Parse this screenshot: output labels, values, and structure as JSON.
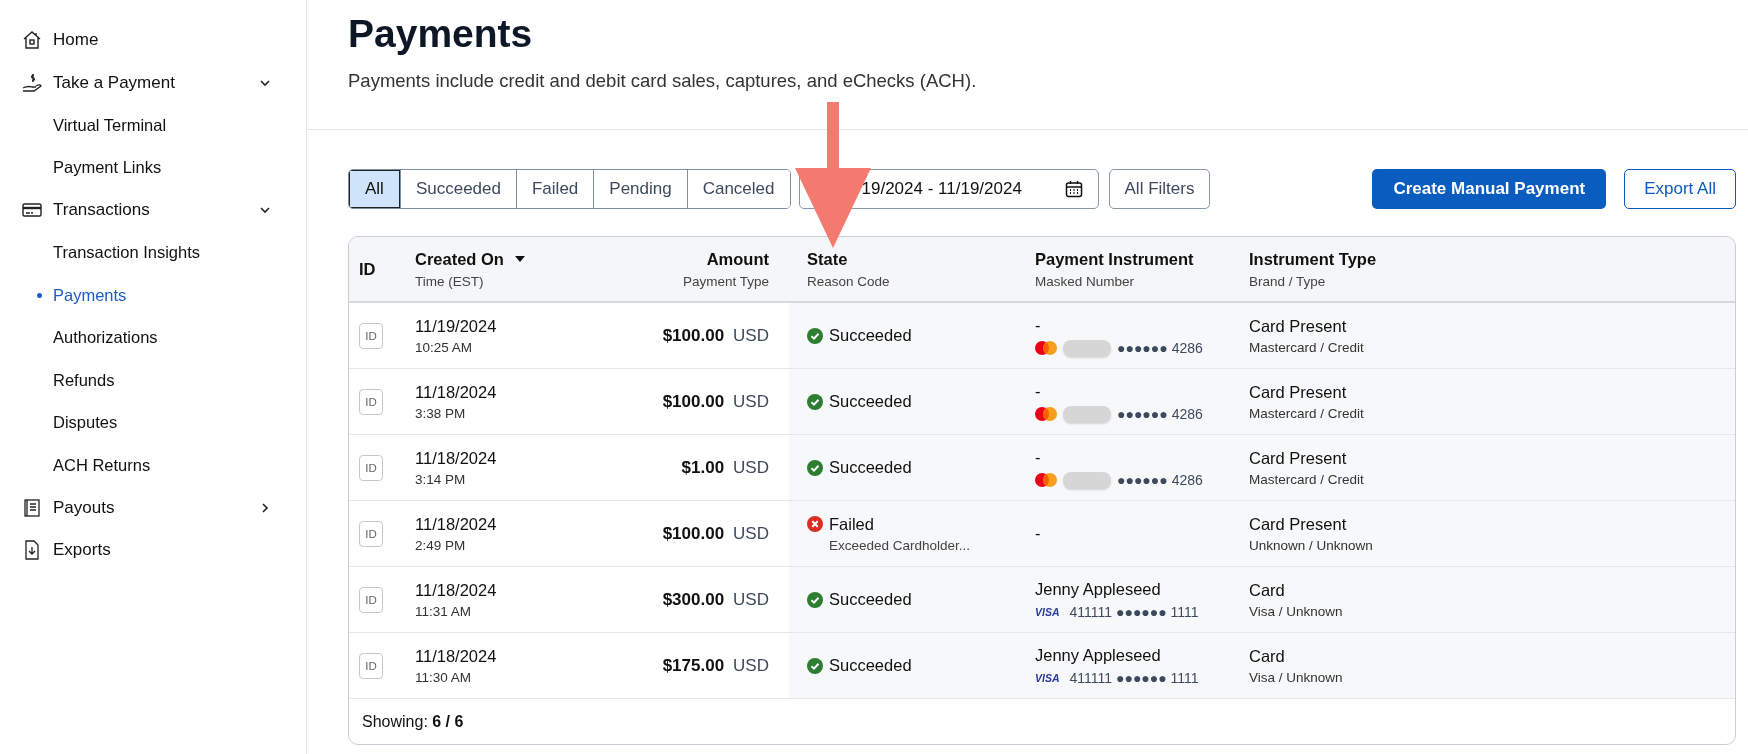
{
  "sidebar": {
    "items": [
      {
        "label": "Home"
      },
      {
        "label": "Take a Payment",
        "expanded": true,
        "children": [
          {
            "label": "Virtual Terminal",
            "selected": false
          },
          {
            "label": "Payment Links",
            "selected": false
          }
        ]
      },
      {
        "label": "Transactions",
        "expanded": true,
        "children": [
          {
            "label": "Transaction Insights",
            "selected": false
          },
          {
            "label": "Payments",
            "selected": true
          },
          {
            "label": "Authorizations",
            "selected": false
          },
          {
            "label": "Refunds",
            "selected": false
          },
          {
            "label": "Disputes",
            "selected": false
          },
          {
            "label": "ACH Returns",
            "selected": false
          }
        ]
      },
      {
        "label": "Payouts",
        "expanded": false
      },
      {
        "label": "Exports"
      }
    ]
  },
  "page": {
    "title": "Payments",
    "subtitle": "Payments include credit and debit card sales, captures, and eChecks (ACH)."
  },
  "filters": {
    "tabs": [
      {
        "label": "All",
        "selected": true
      },
      {
        "label": "Succeeded",
        "selected": false
      },
      {
        "label": "Failed",
        "selected": false
      },
      {
        "label": "Pending",
        "selected": false
      },
      {
        "label": "Canceled",
        "selected": false
      }
    ],
    "date_range": "19/2024 - 11/19/2024",
    "all_filters": "All Filters"
  },
  "actions": {
    "primary": "Create Manual Payment",
    "secondary": "Export All"
  },
  "table": {
    "columns": [
      {
        "title": "ID"
      },
      {
        "title": "Created On",
        "subtitle": "Time (EST)",
        "sorted": true
      },
      {
        "title": "Amount",
        "subtitle": "Payment Type"
      },
      {
        "title": "State",
        "subtitle": "Reason Code"
      },
      {
        "title": "Payment Instrument",
        "subtitle": "Masked Number"
      },
      {
        "title": "Instrument Type",
        "subtitle": "Brand / Type"
      }
    ],
    "rows": [
      {
        "id": "ID",
        "date": "11/19/2024",
        "time": "10:25 AM",
        "amount": "$100.00",
        "currency": "USD",
        "state": {
          "kind": "succeeded",
          "label": "Succeeded"
        },
        "instrument": {
          "name": "-",
          "kind": "mastercard",
          "redacted": true,
          "masked": "●●●●●● 4286"
        },
        "type": "Card Present",
        "brand_type": "Mastercard / Credit"
      },
      {
        "id": "ID",
        "date": "11/18/2024",
        "time": "3:38 PM",
        "amount": "$100.00",
        "currency": "USD",
        "state": {
          "kind": "succeeded",
          "label": "Succeeded"
        },
        "instrument": {
          "name": "-",
          "kind": "mastercard",
          "redacted": true,
          "masked": "●●●●●● 4286"
        },
        "type": "Card Present",
        "brand_type": "Mastercard / Credit"
      },
      {
        "id": "ID",
        "date": "11/18/2024",
        "time": "3:14 PM",
        "amount": "$1.00",
        "currency": "USD",
        "state": {
          "kind": "succeeded",
          "label": "Succeeded"
        },
        "instrument": {
          "name": "-",
          "kind": "mastercard",
          "redacted": true,
          "masked": "●●●●●● 4286"
        },
        "type": "Card Present",
        "brand_type": "Mastercard / Credit"
      },
      {
        "id": "ID",
        "date": "11/18/2024",
        "time": "2:49 PM",
        "amount": "$100.00",
        "currency": "USD",
        "state": {
          "kind": "failed",
          "label": "Failed",
          "reason": "Exceeded Cardholder..."
        },
        "instrument": {
          "name": "-"
        },
        "type": "Card Present",
        "brand_type": "Unknown / Unknown"
      },
      {
        "id": "ID",
        "date": "11/18/2024",
        "time": "11:31 AM",
        "amount": "$300.00",
        "currency": "USD",
        "state": {
          "kind": "succeeded",
          "label": "Succeeded"
        },
        "instrument": {
          "name": "Jenny Appleseed",
          "kind": "visa",
          "logo": "VISA",
          "masked": "411111 ●●●●●● 1111"
        },
        "type": "Card",
        "brand_type": "Visa / Unknown"
      },
      {
        "id": "ID",
        "date": "11/18/2024",
        "time": "11:30 AM",
        "amount": "$175.00",
        "currency": "USD",
        "state": {
          "kind": "succeeded",
          "label": "Succeeded"
        },
        "instrument": {
          "name": "Jenny Appleseed",
          "kind": "visa",
          "logo": "VISA",
          "masked": "411111 ●●●●●● 1111"
        },
        "type": "Card",
        "brand_type": "Visa / Unknown"
      }
    ],
    "footer": "Showing: **6 / 6**"
  }
}
